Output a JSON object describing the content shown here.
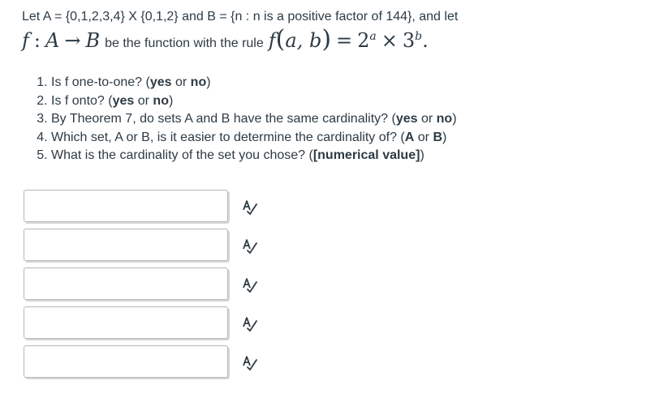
{
  "intro": {
    "line1": "Let A = {0,1,2,3,4} X {0,1,2} and B = {n : n is a positive factor of 144}, and let",
    "function_name": "f",
    "colon": ":",
    "domain_set": "A",
    "arrow": "→",
    "codomain_set": "B",
    "line2_text": "be the function with the rule",
    "rule_fn": "f",
    "rule_open": "(",
    "rule_args": "a, b",
    "rule_close": ")",
    "rule_eq": "=",
    "base1": "2",
    "exp1": "a",
    "times": "×",
    "base2": "3",
    "exp2": "b",
    "period": "."
  },
  "questions": [
    {
      "text": "Is f one-to-one? (",
      "opt1": "yes",
      "mid": " or ",
      "opt2": "no",
      "end": ")"
    },
    {
      "text": "Is f onto? (",
      "opt1": "yes",
      "mid": " or ",
      "opt2": "no",
      "end": ")"
    },
    {
      "text": "By Theorem 7, do sets A and B have the same cardinality? (",
      "opt1": "yes",
      "mid": " or ",
      "opt2": "no",
      "end": ")"
    },
    {
      "text": "Which set, A or B, is it easier to determine the cardinality of? (",
      "opt1": "A",
      "mid": " or ",
      "opt2": "B",
      "end": ")"
    },
    {
      "text": "What is the cardinality of the set you chose? (",
      "opt1": "[numerical value]",
      "mid": "",
      "opt2": "",
      "end": ")"
    }
  ],
  "answers": [
    {
      "value": "",
      "icon": "spell-check-icon"
    },
    {
      "value": "",
      "icon": "spell-check-icon"
    },
    {
      "value": "",
      "icon": "spell-check-icon"
    },
    {
      "value": "",
      "icon": "spell-check-icon"
    },
    {
      "value": "",
      "icon": "spell-check-icon"
    }
  ],
  "colors": {
    "text": "#2d3b45",
    "input_border": "#b7b7b7",
    "icon": "#2d3b45"
  }
}
